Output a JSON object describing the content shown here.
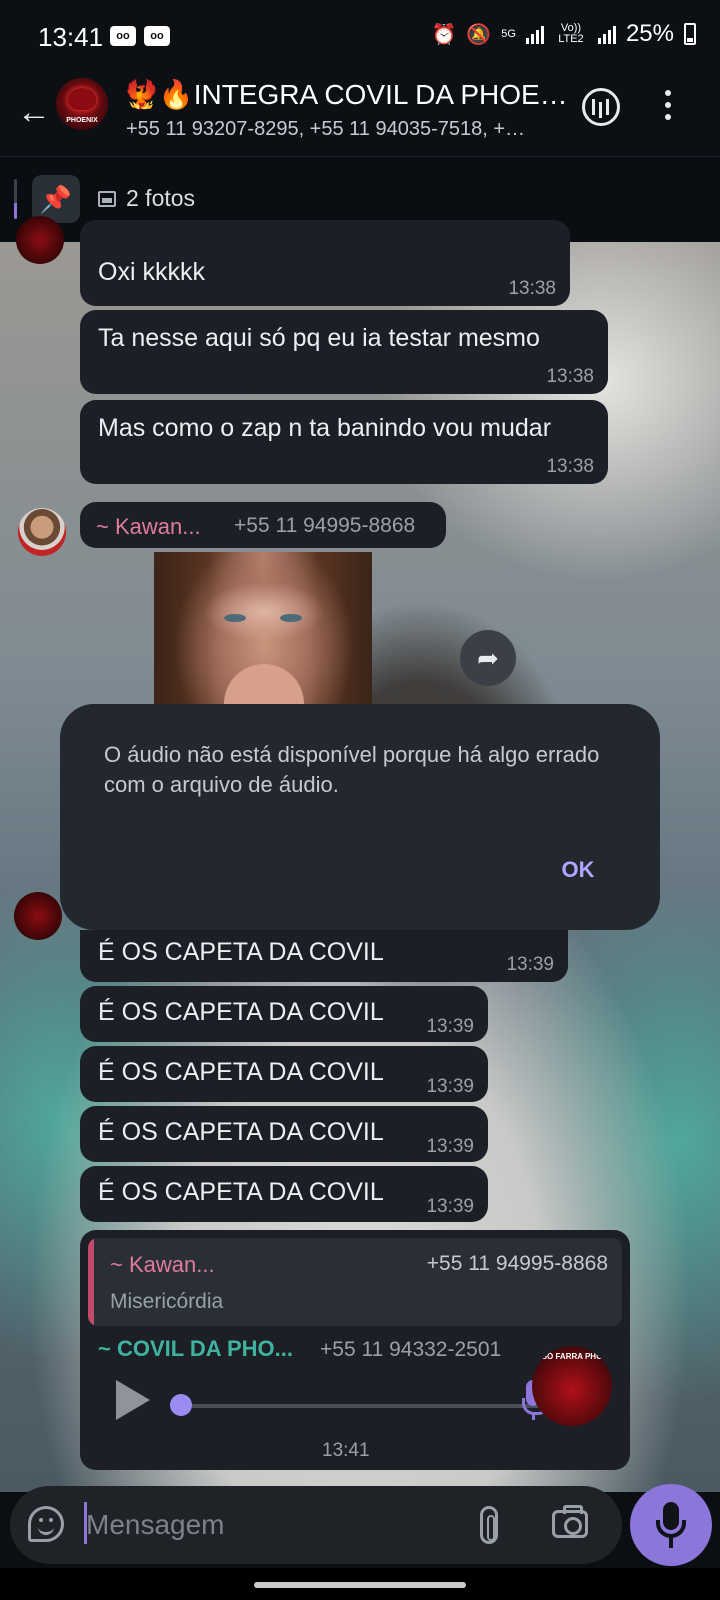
{
  "status_bar": {
    "time": "13:41",
    "battery": "25%",
    "network_5g": "5G",
    "volte": "Vo)) LTE2",
    "icons": [
      "voicemail-icon",
      "voicemail-icon",
      "alarm-icon",
      "mute-icon",
      "signal-icon",
      "signal-icon",
      "battery-icon"
    ]
  },
  "header": {
    "title": "🐦‍🔥🔥INTEGRA COVIL DA PHOE…",
    "subtitle": "+55 11 93207-8295, +55 11 94035-7518, +…",
    "avatar_label": "PHOENIX"
  },
  "pinned": {
    "text": "2 fotos"
  },
  "messages": [
    {
      "text": "Oxi kkkkk",
      "time": "13:38"
    },
    {
      "text": "Ta nesse aqui só pq eu ia testar mesmo",
      "time": "13:38"
    },
    {
      "text": "Mas como o zap n ta banindo vou mudar",
      "time": "13:38"
    }
  ],
  "kawan_header": {
    "name": "~ Kawan...",
    "phone": "+55 11 94995-8868"
  },
  "dialog": {
    "message": "O áudio não está disponível porque há algo errado com o arquivo de áudio.",
    "ok": "OK"
  },
  "capeta_messages": [
    {
      "text": "É OS CAPETA DA COVIL",
      "time": "13:39"
    },
    {
      "text": "É OS CAPETA DA COVIL",
      "time": "13:39"
    },
    {
      "text": "É OS CAPETA DA COVIL",
      "time": "13:39"
    },
    {
      "text": "É OS CAPETA DA COVIL",
      "time": "13:39"
    },
    {
      "text": "É OS CAPETA DA COVIL",
      "time": "13:39"
    }
  ],
  "reply": {
    "quote_name": "~ Kawan...",
    "quote_phone": "+55 11 94995-8868",
    "quote_text": "Misericórdia",
    "sender": "~ COVIL DA PHO...",
    "sender_phone": "+55 11 94332-2501",
    "time": "13:41",
    "avatar_label": "SÓ FARRA PHO"
  },
  "input": {
    "placeholder": "Mensagem"
  },
  "colors": {
    "accent": "#8d76d9",
    "bubble": "#1c2026",
    "header_bg": "#0c1014",
    "sender_green": "#3fb39f",
    "sender_pink": "#e07b9d"
  }
}
